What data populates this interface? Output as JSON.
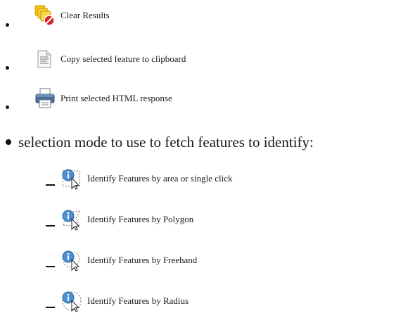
{
  "items": [
    {
      "label": "Clear Results",
      "icon": "clear-results-icon"
    },
    {
      "label": "Copy selected feature to clipboard",
      "icon": "copy-clipboard-icon"
    },
    {
      "label": "Print selected HTML response",
      "icon": "printer-icon"
    }
  ],
  "selection_mode": {
    "heading": "selection mode to use to fetch features to identify:",
    "options": [
      {
        "label": "Identify Features by area or single click",
        "icon": "identify-area-click-icon"
      },
      {
        "label": "Identify Features by Polygon",
        "icon": "identify-polygon-icon"
      },
      {
        "label": "Identify Features by Freehand",
        "icon": "identify-freehand-icon"
      },
      {
        "label": "Identify Features by Radius",
        "icon": "identify-radius-icon"
      }
    ]
  }
}
